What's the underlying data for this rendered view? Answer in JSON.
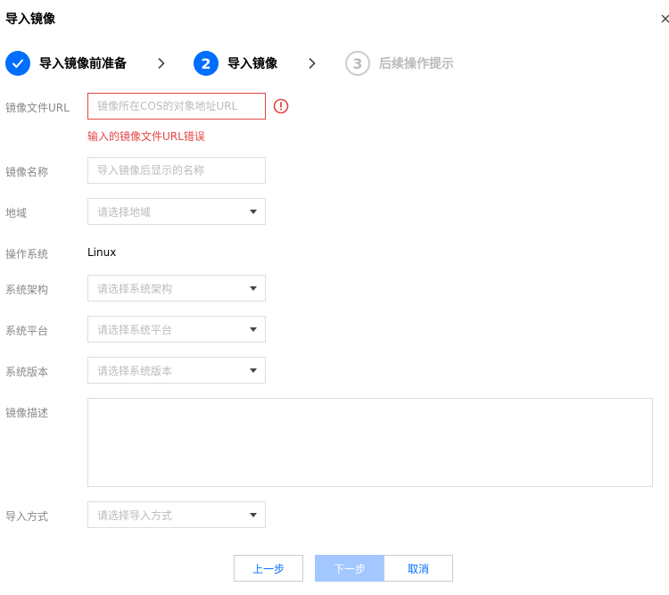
{
  "dialog": {
    "title": "导入镜像"
  },
  "steps": [
    {
      "index": "1",
      "label": "导入镜像前准备",
      "state": "done"
    },
    {
      "index": "2",
      "label": "导入镜像",
      "state": "active"
    },
    {
      "index": "3",
      "label": "后续操作提示",
      "state": "todo"
    }
  ],
  "form": {
    "image_url": {
      "label": "镜像文件URL",
      "placeholder": "镜像所在COS的对象地址URL",
      "value": "",
      "error": "输入的镜像文件URL错误"
    },
    "image_name": {
      "label": "镜像名称",
      "placeholder": "导入镜像后显示的名称",
      "value": ""
    },
    "region": {
      "label": "地域",
      "placeholder": "请选择地域"
    },
    "os": {
      "label": "操作系统",
      "value": "Linux"
    },
    "arch": {
      "label": "系统架构",
      "placeholder": "请选择系统架构"
    },
    "platform": {
      "label": "系统平台",
      "placeholder": "请选择系统平台"
    },
    "version": {
      "label": "系统版本",
      "placeholder": "请选择系统版本"
    },
    "description": {
      "label": "镜像描述",
      "value": ""
    },
    "import_method": {
      "label": "导入方式",
      "placeholder": "请选择导入方式"
    }
  },
  "footer": {
    "prev_label": "上一步",
    "next_label": "下一步",
    "cancel_label": "取消"
  },
  "colors": {
    "accent": "#006eff",
    "error": "#e54545",
    "disabled_button": "#a3c7ff",
    "border": "#dddddd"
  },
  "icons": {
    "step_done": "check-icon",
    "step_arrow": "chevron-right-icon",
    "field_error": "exclamation-circle-icon",
    "select_caret": "caret-down-icon",
    "close": "close-icon"
  }
}
